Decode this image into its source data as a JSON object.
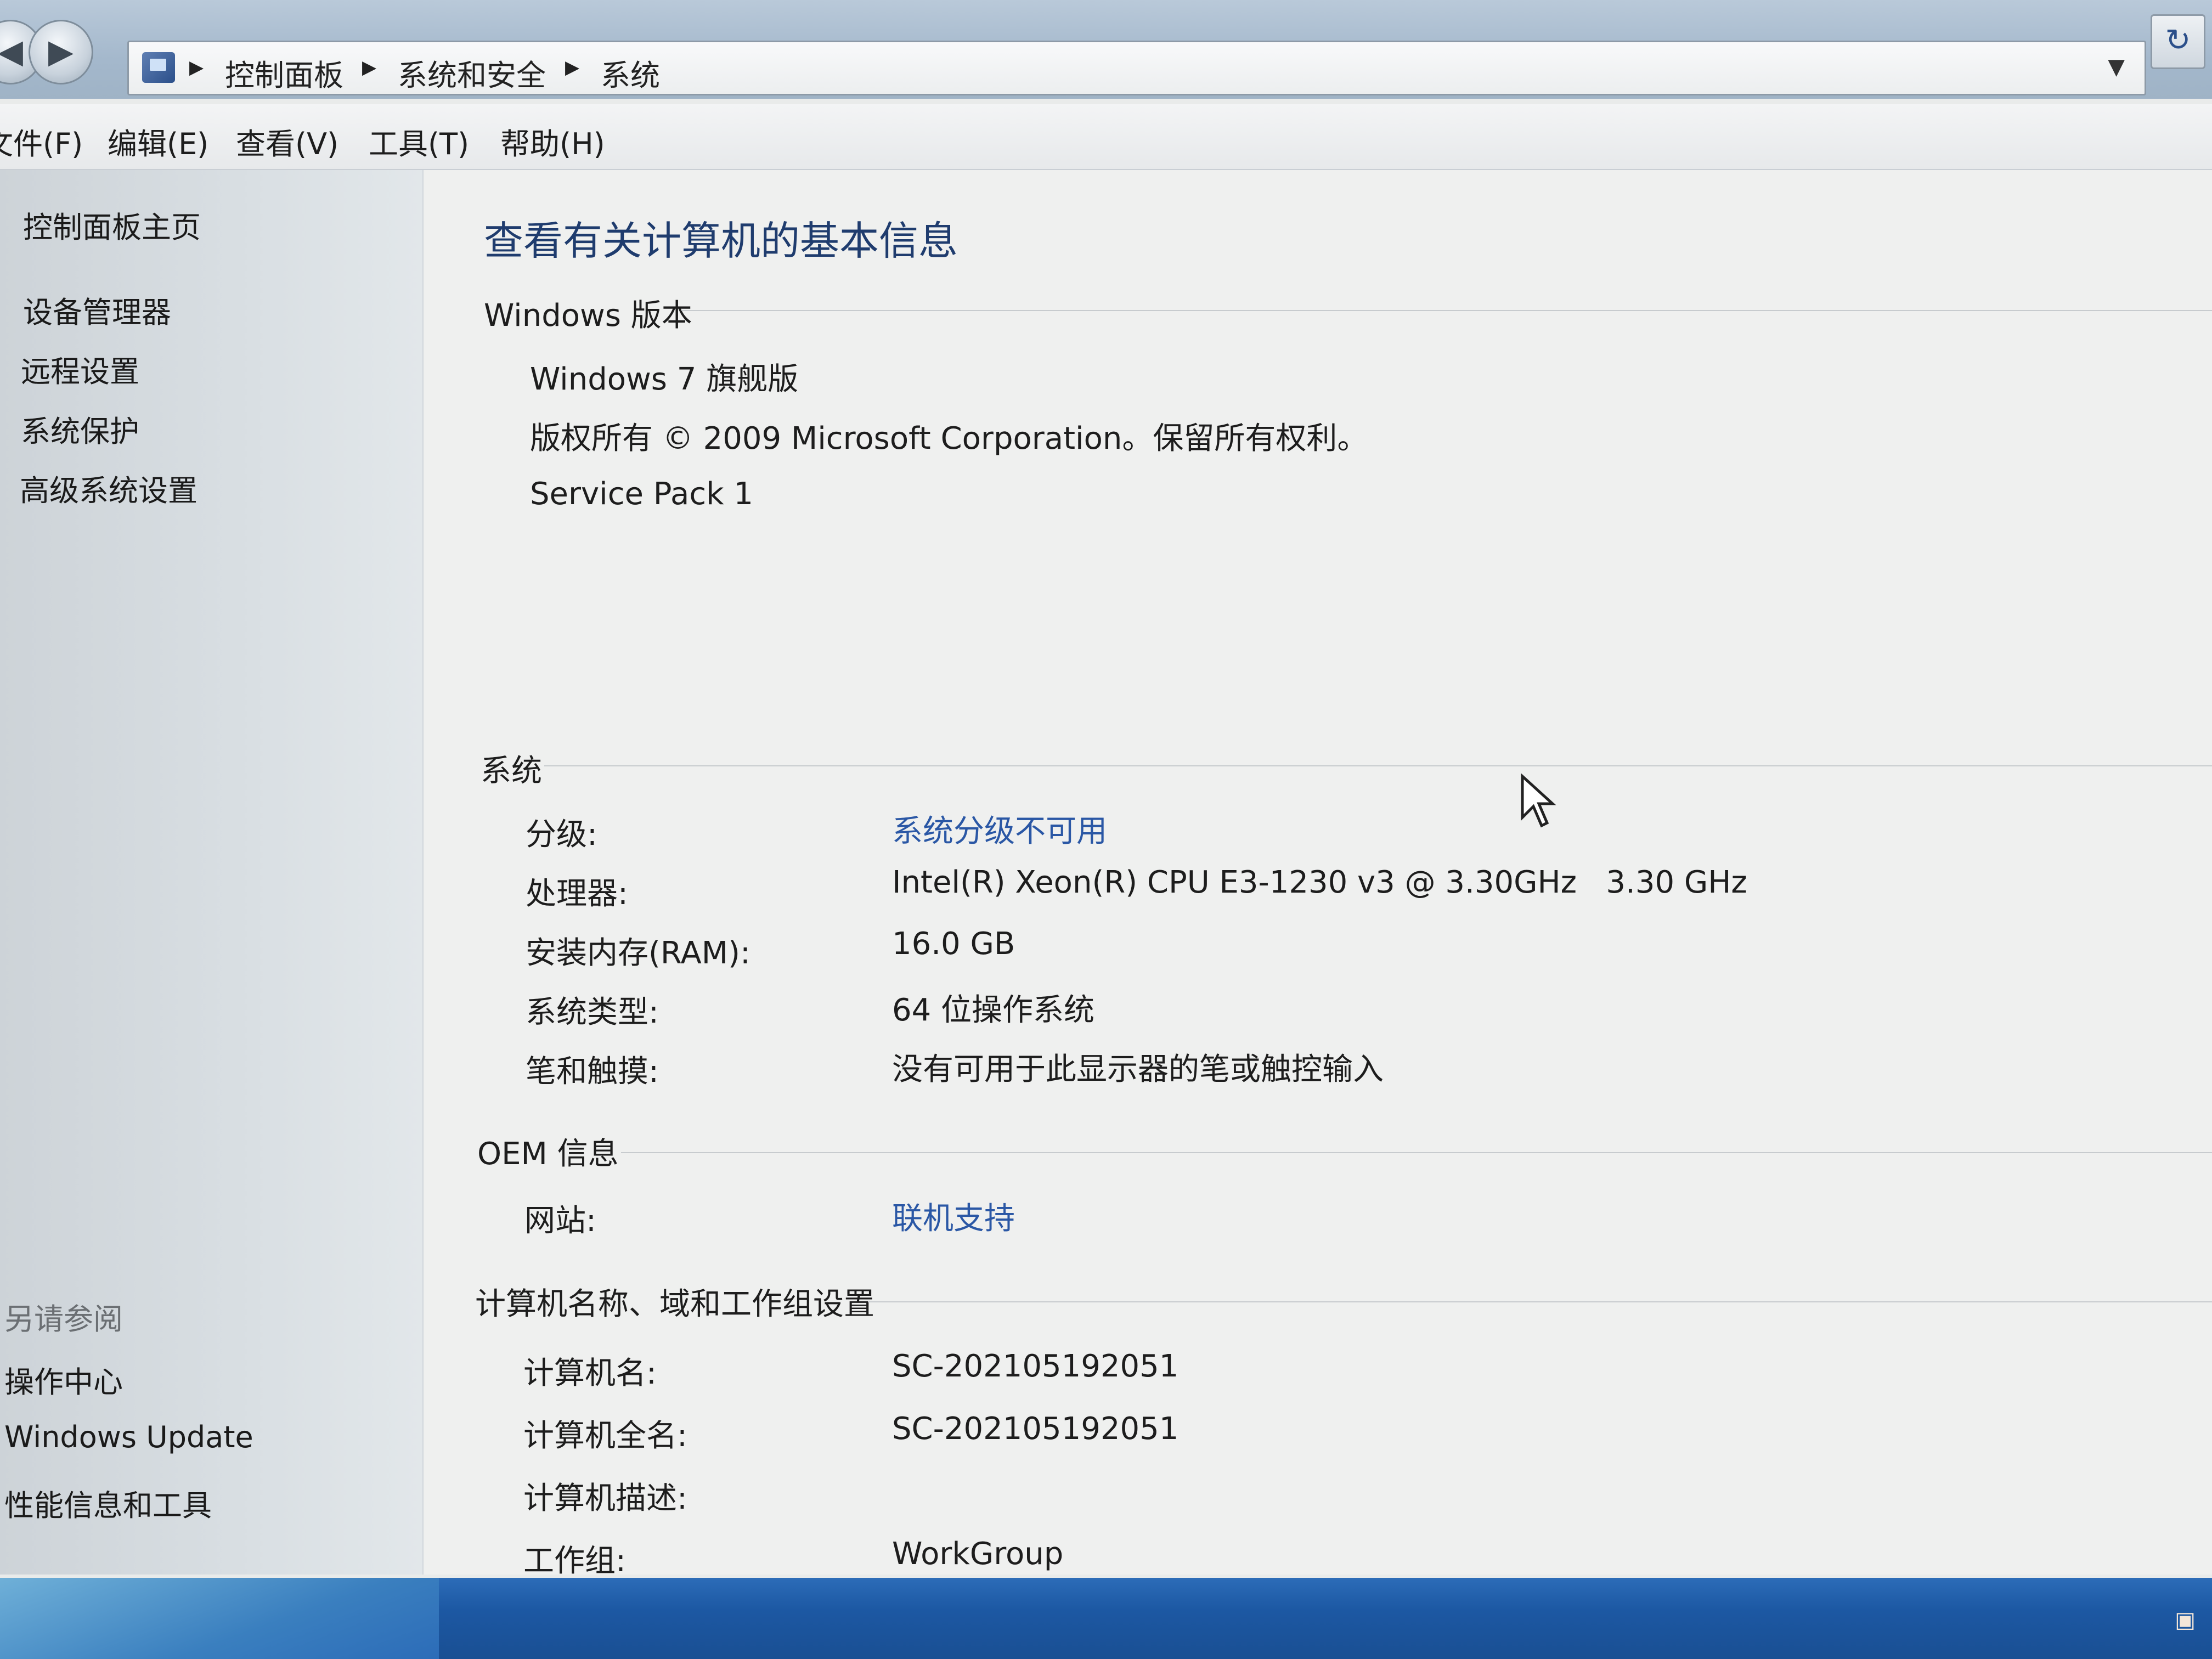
{
  "address_bar": {
    "crumbs": [
      "控制面板",
      "系统和安全",
      "系统"
    ]
  },
  "menu": {
    "items": [
      "文件(F)",
      "编辑(E)",
      "查看(V)",
      "工具(T)",
      "帮助(H)"
    ]
  },
  "sidebar": {
    "home": "控制面板主页",
    "tasks": [
      "设备管理器",
      "远程设置",
      "系统保护",
      "高级系统设置"
    ],
    "see_also_heading": "另请参阅",
    "see_also": [
      "操作中心",
      "Windows Update",
      "性能信息和工具"
    ]
  },
  "main": {
    "title": "查看有关计算机的基本信息",
    "windows_edition": {
      "heading": "Windows 版本",
      "edition": "Windows 7 旗舰版",
      "copyright": "版权所有 © 2009 Microsoft Corporation。保留所有权利。",
      "service_pack": "Service Pack 1"
    },
    "system": {
      "heading": "系统",
      "rows": [
        {
          "label": "分级:",
          "value": "系统分级不可用"
        },
        {
          "label": "处理器:",
          "value": "Intel(R) Xeon(R) CPU E3-1230 v3 @ 3.30GHz   3.30 GHz"
        },
        {
          "label": "安装内存(RAM):",
          "value": "16.0 GB"
        },
        {
          "label": "系统类型:",
          "value": "64 位操作系统"
        },
        {
          "label": "笔和触摸:",
          "value": "没有可用于此显示器的笔或触控输入"
        }
      ]
    },
    "oem": {
      "heading": "OEM 信息",
      "rows": [
        {
          "label": "网站:",
          "value": "联机支持"
        }
      ]
    },
    "computer_name": {
      "heading": "计算机名称、域和工作组设置",
      "rows": [
        {
          "label": "计算机名:",
          "value": "SC-202105192051"
        },
        {
          "label": "计算机全名:",
          "value": "SC-202105192051"
        },
        {
          "label": "计算机描述:",
          "value": ""
        },
        {
          "label": "工作组:",
          "value": "WorkGroup"
        }
      ]
    }
  },
  "icons": {
    "back": "back-arrow-icon",
    "forward": "forward-arrow-icon",
    "control_panel": "control-panel-icon",
    "refresh": "refresh-icon",
    "cursor": "mouse-cursor-icon"
  },
  "colors": {
    "link": "#2a57a5",
    "title": "#1f3c6e",
    "taskbar": "#1c58a3"
  }
}
